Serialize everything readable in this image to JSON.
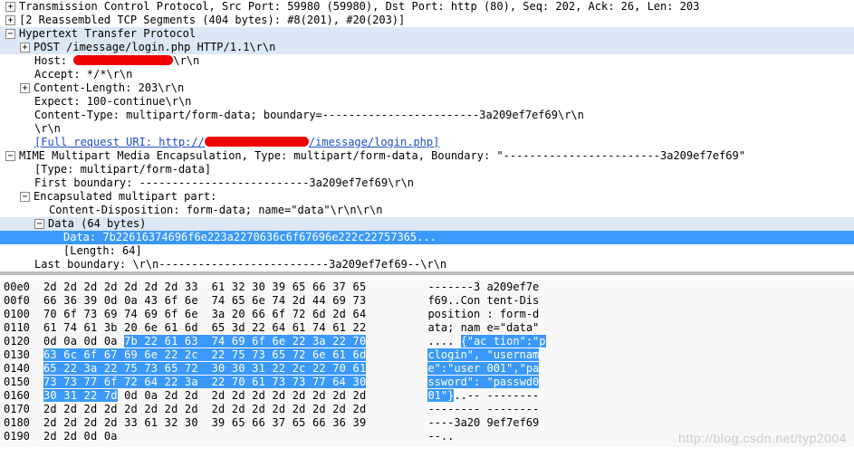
{
  "tree": {
    "tcp": "Transmission Control Protocol, Src Port: 59980 (59980), Dst Port: http (80), Seq: 202, Ack: 26, Len: 203",
    "reassembled": "[2 Reassembled TCP Segments (404 bytes): #8(201), #20(203)]",
    "http": "Hypertext Transfer Protocol",
    "post": "POST /imessage/login.php HTTP/1.1\\r\\n",
    "host_pre": "Host: ",
    "host_post": "\\r\\n",
    "accept": "Accept: */*\\r\\n",
    "clen": "Content-Length: 203\\r\\n",
    "expect": "Expect: 100-continue\\r\\n",
    "ctype": "Content-Type: multipart/form-data; boundary=------------------------3a209ef7ef69\\r\\n",
    "crlf": "\\r\\n",
    "fulluri_a": "[Full request URI: http://",
    "fulluri_b": "/imessage/login.php]",
    "mime": "MIME Multipart Media Encapsulation, Type: multipart/form-data, Boundary: \"------------------------3a209ef7ef69\"",
    "mimetype": "[Type: multipart/form-data]",
    "firstboundary": "First boundary: --------------------------3a209ef7ef69\\r\\n",
    "encap": "Encapsulated multipart part:",
    "cdisp": "Content-Disposition: form-data; name=\"data\"\\r\\n\\r\\n",
    "data64": "Data (64 bytes)",
    "datahex": "Data: 7b22616374696f6e223a2270636c6f67696e222c22757365...",
    "datalen": "[Length: 64]",
    "lastboundary": "Last boundary: \\r\\n--------------------------3a209ef7ef69--\\r\\n"
  },
  "hex": {
    "rows": [
      {
        "off": "00e0",
        "b": "2d 2d 2d 2d 2d 2d 2d 33  61 32 30 39 65 66 37 65",
        "a": "-------3 a209ef7e"
      },
      {
        "off": "00f0",
        "b": "66 36 39 0d 0a 43 6f 6e  74 65 6e 74 2d 44 69 73",
        "a": "f69..Con tent-Dis"
      },
      {
        "off": "0100",
        "b": "70 6f 73 69 74 69 6f 6e  3a 20 66 6f 72 6d 2d 64",
        "a": "position : form-d"
      },
      {
        "off": "0110",
        "b": "61 74 61 3b 20 6e 61 6d  65 3d 22 64 61 74 61 22",
        "a": "ata; nam e=\"data\""
      }
    ],
    "hl_rows": [
      {
        "off": "0120",
        "b_pre": "0d 0a 0d 0a ",
        "b_hl": "7b 22 61 63  74 69 6f 6e 22 3a 22 70",
        "a_pre": ".... ",
        "a_hl": "{\"ac tion\":\"p"
      },
      {
        "off": "0130",
        "b_hl": "63 6c 6f 67 69 6e 22 2c  22 75 73 65 72 6e 61 6d",
        "a_hl": "clogin\", \"usernam"
      },
      {
        "off": "0140",
        "b_hl": "65 22 3a 22 75 73 65 72  30 30 31 22 2c 22 70 61",
        "a_hl": "e\":\"user 001\",\"pa"
      },
      {
        "off": "0150",
        "b_hl": "73 73 77 6f 72 64 22 3a  22 70 61 73 73 77 64 30",
        "a_hl": "ssword\": \"passwd0"
      },
      {
        "off": "0160",
        "b_hl": "30 31 22 7d",
        "b_post": " 0d 0a 2d 2d  2d 2d 2d 2d 2d 2d 2d 2d",
        "a_hl": "01\"}",
        "a_post": "..-- --------"
      }
    ],
    "rows2": [
      {
        "off": "0170",
        "b": "2d 2d 2d 2d 2d 2d 2d 2d  2d 2d 2d 2d 2d 2d 2d 2d",
        "a": "-------- --------"
      },
      {
        "off": "0180",
        "b": "2d 2d 2d 2d 33 61 32 30  39 65 66 37 65 66 36 39",
        "a": "----3a20 9ef7ef69"
      },
      {
        "off": "0190",
        "b": "2d 2d 0d 0a",
        "a": "--.."
      }
    ]
  },
  "watermark": "http://blog.csdn.net/typ2004"
}
